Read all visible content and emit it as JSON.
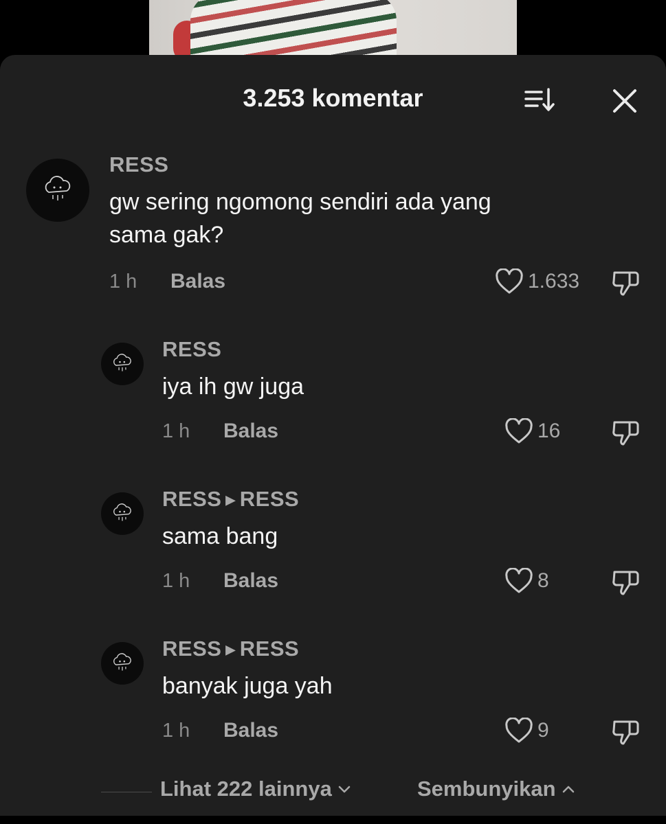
{
  "header": {
    "title": "3.253 komentar",
    "sort_icon": "sort-icon",
    "close_icon": "close-icon"
  },
  "comments": [
    {
      "username": "RESS",
      "text_line1": "gw sering ngomong sendiri ada yang",
      "text_line2": "sama gak?",
      "time": "1 h",
      "reply_label": "Balas",
      "likes": "1.633"
    },
    {
      "username": "RESS",
      "text": "iya ih gw juga",
      "time": "1 h",
      "reply_label": "Balas",
      "likes": "16"
    },
    {
      "username": "RESS",
      "reply_to": "RESS",
      "text": "sama bang",
      "time": "1 h",
      "reply_label": "Balas",
      "likes": "8"
    },
    {
      "username": "RESS",
      "reply_to": "RESS",
      "text": "banyak juga yah",
      "time": "1 h",
      "reply_label": "Balas",
      "likes": "9"
    }
  ],
  "footer": {
    "more_label": "Lihat 222 lainnya",
    "hide_label": "Sembunyikan"
  },
  "colors": {
    "sheet_bg": "#1f1f1f",
    "muted_text": "#a9a9a9",
    "primary_text": "#f4f4f4"
  }
}
